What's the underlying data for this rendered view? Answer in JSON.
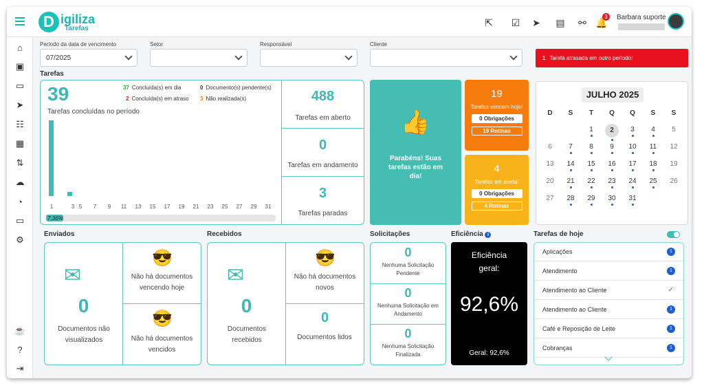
{
  "header": {
    "logo_letter": "D",
    "logo_name": "igiliza",
    "logo_sub": "Tarefas",
    "user_name": "Barbara suporte",
    "notif_count": "3"
  },
  "filters": {
    "period_label": "Período da data de vencimento",
    "period_value": "07/2025",
    "setor_label": "Setor",
    "resp_label": "Responsável",
    "cliente_label": "Cliente"
  },
  "alert": {
    "count": "1",
    "text": "Tarefa atrasada em outro período!"
  },
  "tarefas": {
    "section": "Tarefas",
    "concluded": "39",
    "concluded_label": "Tarefas concluídas no período",
    "legend": [
      {
        "n": "37",
        "t": "Concluída(s) em dia",
        "c": "#3aa840"
      },
      {
        "n": "2",
        "t": "Concluída(s) em atraso",
        "c": "#e21b2b"
      },
      {
        "n": "0",
        "t": "Documento(s) pendente(s)",
        "c": "#333333"
      },
      {
        "n": "3",
        "t": "Não realizada(s)",
        "c": "#f08a00"
      }
    ],
    "progress": "7,36%",
    "progress_value": 7.36,
    "open": "488",
    "open_label": "Tarefas em aberto",
    "andamento": "0",
    "andamento_label": "Tarefas em andamento",
    "paradas": "3",
    "paradas_label": "Tarefas paradas"
  },
  "chart_data": {
    "type": "bar",
    "categories": [
      "1",
      "3",
      "5",
      "7",
      "9",
      "11",
      "13",
      "15",
      "17",
      "19",
      "21",
      "23",
      "25",
      "27",
      "29",
      "31"
    ],
    "values": [
      37,
      2,
      0,
      0,
      0,
      0,
      0,
      0,
      0,
      0,
      0,
      0,
      0,
      0,
      0,
      0
    ],
    "ylim": [
      0,
      39
    ]
  },
  "congrats": {
    "text": "Parabéns! Suas tarefas estão em dia!"
  },
  "vencem": {
    "num": "19",
    "label": "Tarefas vencem hoje!",
    "obr": "0 Obrigações",
    "rot": "19 Rotinas"
  },
  "alerta": {
    "num": "4",
    "label": "Tarefas em alerta!",
    "obr": "0 Obrigações",
    "rot": "4 Rotinas"
  },
  "calendar": {
    "title": "JULHO 2025",
    "weekdays": [
      "D",
      "S",
      "T",
      "Q",
      "Q",
      "S",
      "S"
    ],
    "days": [
      [
        "",
        "",
        "1",
        "2",
        "3",
        "4",
        "5"
      ],
      [
        "6",
        "7",
        "8",
        "9",
        "10",
        "11",
        "12"
      ],
      [
        "13",
        "14",
        "15",
        "16",
        "17",
        "18",
        "19"
      ],
      [
        "20",
        "21",
        "22",
        "23",
        "24",
        "25",
        "26"
      ],
      [
        "27",
        "28",
        "29",
        "30",
        "31",
        "",
        ""
      ]
    ]
  },
  "enviados": {
    "section": "Enviados",
    "count": "0",
    "label": "Documentos não visualizados",
    "vencendo": "Não há documentos vencendo hoje",
    "vencidos": "Não há documentos vencidos"
  },
  "recebidos": {
    "section": "Recebidos",
    "count": "0",
    "label": "Documentos recebidos",
    "novos": "Não há documentos novos",
    "lidos_num": "0",
    "lidos": "Documentos lidos"
  },
  "solicitacoes": {
    "section": "Solicitações",
    "items": [
      {
        "n": "0",
        "t": "Nenhuma Solicitação Pendente"
      },
      {
        "n": "0",
        "t": "Nenhuma Solicitação em Andamento"
      },
      {
        "n": "0",
        "t": "Nenhuma Solicitação Finalizada"
      }
    ]
  },
  "eficiencia": {
    "section": "Eficiência",
    "title": "Eficiência geral:",
    "value": "92,6%",
    "footer": "Geral: 92,6%"
  },
  "hoje": {
    "section": "Tarefas de hoje",
    "items": [
      {
        "t": "Aplicações",
        "b": "1"
      },
      {
        "t": "Atendimento",
        "b": "1"
      },
      {
        "t": "Atendimento ao Cliente",
        "b": "✓"
      },
      {
        "t": "Atendimento ao Cliente",
        "b": "1"
      },
      {
        "t": "Café e Reposição de Leite",
        "b": "1"
      },
      {
        "t": "Cobranças",
        "b": "1"
      }
    ]
  },
  "colors": {
    "accent": "#1bc1ba",
    "orange": "#f47b0c",
    "yellow": "#f8b31a",
    "red": "#e8121f"
  }
}
